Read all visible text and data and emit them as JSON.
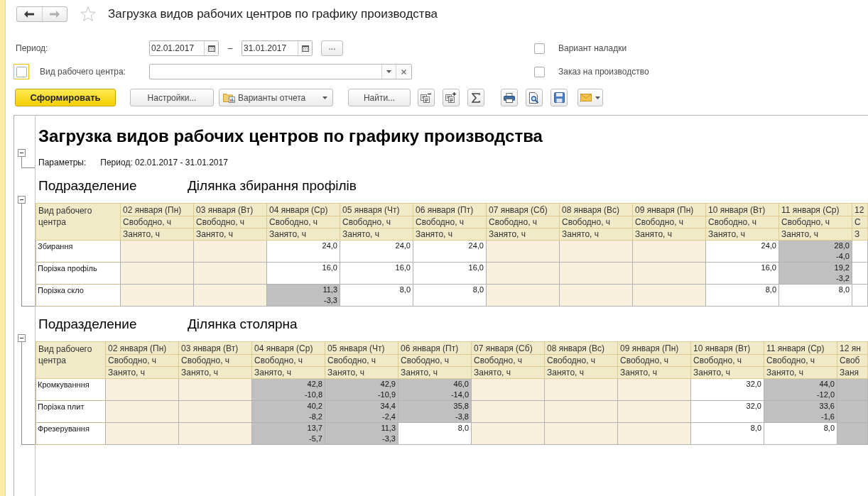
{
  "window": {
    "title": "Загрузка видов рабочих центров по графику производства",
    "favorite": false
  },
  "navigation": [
    {
      "kind": "back",
      "disabled": false
    },
    {
      "kind": "forward",
      "disabled": true
    }
  ],
  "filters": {
    "period": {
      "label": "Период:",
      "from": "02.01.2017",
      "separator": "–",
      "to": "31.01.2017",
      "more": "..."
    },
    "work_center": {
      "label": "Вид рабочего центра:",
      "checked": false,
      "focused": true
    },
    "options": [
      {
        "label": "Вариант наладки",
        "checked": false
      },
      {
        "label": "Заказ на производство",
        "checked": false
      }
    ]
  },
  "toolbar": [
    {
      "kind": "primary",
      "label": "Сформировать"
    },
    {
      "kind": "plain",
      "label": "Настройки..."
    },
    {
      "kind": "menu",
      "label": "Варианты отчета"
    },
    {
      "kind": "plain",
      "label": "Найти..."
    }
  ],
  "report": {
    "title": "Загрузка видов рабочих центров по графику производства",
    "expanded": true,
    "parameters_label": "Параметры:",
    "parameters_value": "Период: 02.01.2017 - 31.01.2017",
    "groups": [
      {
        "label": "Подразделение",
        "value": "Ділянка збирання профілів",
        "expanded": true,
        "corner_header": "Вид рабочего центра",
        "columns": [
          {
            "date": "02 января (Пн)",
            "free": "Свободно, ч",
            "busy": "Занято, ч"
          },
          {
            "date": "03 января (Вт)",
            "free": "Свободно, ч",
            "busy": "Занято, ч"
          },
          {
            "date": "04 января (Ср)",
            "free": "Свободно, ч",
            "busy": "Занято, ч"
          },
          {
            "date": "05 января (Чт)",
            "free": "Свободно, ч",
            "busy": "Занято, ч"
          },
          {
            "date": "06 января (Пт)",
            "free": "Свободно, ч",
            "busy": "Занято, ч"
          },
          {
            "date": "07 января (Сб)",
            "free": "Свободно, ч",
            "busy": "Занято, ч"
          },
          {
            "date": "08 января (Вс)",
            "free": "Свободно, ч",
            "busy": "Занято, ч"
          },
          {
            "date": "09 января (Пн)",
            "free": "Свободно, ч",
            "busy": "Занято, ч"
          },
          {
            "date": "10 января (Вт)",
            "free": "Свободно, ч",
            "busy": "Занято, ч"
          },
          {
            "date": "11 января (Ср)",
            "free": "Свободно, ч",
            "busy": "Занято, ч"
          },
          {
            "date": "12",
            "free": "С",
            "busy": "З"
          }
        ],
        "rows": [
          {
            "name": "Збирання",
            "cells": [
              {
                "kind": "off"
              },
              {
                "kind": "off"
              },
              {
                "kind": "free",
                "value": "24,0"
              },
              {
                "kind": "free",
                "value": "24,0"
              },
              {
                "kind": "free",
                "value": "24,0"
              },
              {
                "kind": "off"
              },
              {
                "kind": "off"
              },
              {
                "kind": "off"
              },
              {
                "kind": "free",
                "value": "24,0"
              },
              {
                "kind": "over",
                "value": "28,0",
                "deficit": "-4,0"
              },
              {
                "kind": "free"
              }
            ]
          },
          {
            "name": "Порізка профіль",
            "cells": [
              {
                "kind": "off"
              },
              {
                "kind": "off"
              },
              {
                "kind": "free",
                "value": "16,0"
              },
              {
                "kind": "free",
                "value": "16,0"
              },
              {
                "kind": "free",
                "value": "16,0"
              },
              {
                "kind": "off"
              },
              {
                "kind": "off"
              },
              {
                "kind": "off"
              },
              {
                "kind": "free",
                "value": "16,0"
              },
              {
                "kind": "over",
                "value": "19,2",
                "deficit": "-3,2"
              },
              {
                "kind": "free"
              }
            ]
          },
          {
            "name": "Порізка скло",
            "cells": [
              {
                "kind": "off"
              },
              {
                "kind": "off"
              },
              {
                "kind": "over",
                "value": "11,3",
                "deficit": "-3,3"
              },
              {
                "kind": "free",
                "value": "8,0"
              },
              {
                "kind": "free",
                "value": "8,0"
              },
              {
                "kind": "off"
              },
              {
                "kind": "off"
              },
              {
                "kind": "off"
              },
              {
                "kind": "free",
                "value": "8,0"
              },
              {
                "kind": "free",
                "value": "8,0"
              },
              {
                "kind": "free"
              }
            ]
          }
        ]
      },
      {
        "label": "Подразделение",
        "value": "Ділянка столярна",
        "expanded": true,
        "corner_header": "Вид рабочего центра",
        "columns": [
          {
            "date": "02 января (Пн)",
            "free": "Свободно, ч",
            "busy": "Занято, ч"
          },
          {
            "date": "03 января (Вт)",
            "free": "Свободно, ч",
            "busy": "Занято, ч"
          },
          {
            "date": "04 января (Ср)",
            "free": "Свободно, ч",
            "busy": "Занято, ч"
          },
          {
            "date": "05 января (Чт)",
            "free": "Свободно, ч",
            "busy": "Занято, ч"
          },
          {
            "date": "06 января (Пт)",
            "free": "Свободно, ч",
            "busy": "Занято, ч"
          },
          {
            "date": "07 января (Сб)",
            "free": "Свободно, ч",
            "busy": "Занято, ч"
          },
          {
            "date": "08 января (Вс)",
            "free": "Свободно, ч",
            "busy": "Занято, ч"
          },
          {
            "date": "09 января (Пн)",
            "free": "Свободно, ч",
            "busy": "Занято, ч"
          },
          {
            "date": "10 января (Вт)",
            "free": "Свободно, ч",
            "busy": "Занято, ч"
          },
          {
            "date": "11 января (Ср)",
            "free": "Свободно, ч",
            "busy": "Занято, ч"
          },
          {
            "date": "12 ян",
            "free": "Своб",
            "busy": "Заня"
          }
        ],
        "rows": [
          {
            "name": "Кромкуванння",
            "cells": [
              {
                "kind": "off"
              },
              {
                "kind": "off"
              },
              {
                "kind": "over",
                "value": "42,8",
                "deficit": "-10,8"
              },
              {
                "kind": "over",
                "value": "42,9",
                "deficit": "-10,9"
              },
              {
                "kind": "over",
                "value": "46,0",
                "deficit": "-14,0"
              },
              {
                "kind": "off"
              },
              {
                "kind": "off"
              },
              {
                "kind": "off"
              },
              {
                "kind": "free",
                "value": "32,0"
              },
              {
                "kind": "over",
                "value": "44,0",
                "deficit": "-12,0"
              },
              {
                "kind": "over"
              }
            ]
          },
          {
            "name": "Порізка плит",
            "cells": [
              {
                "kind": "off"
              },
              {
                "kind": "off"
              },
              {
                "kind": "over",
                "value": "40,2",
                "deficit": "-8,2"
              },
              {
                "kind": "over",
                "value": "34,4",
                "deficit": "-2,4"
              },
              {
                "kind": "over",
                "value": "35,8",
                "deficit": "-3,8"
              },
              {
                "kind": "off"
              },
              {
                "kind": "off"
              },
              {
                "kind": "off"
              },
              {
                "kind": "free",
                "value": "32,0"
              },
              {
                "kind": "over",
                "value": "33,6",
                "deficit": "-1,6"
              },
              {
                "kind": "over"
              }
            ]
          },
          {
            "name": "Фрезерування",
            "cells": [
              {
                "kind": "off"
              },
              {
                "kind": "off"
              },
              {
                "kind": "over",
                "value": "13,7",
                "deficit": "-5,7"
              },
              {
                "kind": "over",
                "value": "11,3",
                "deficit": "-3,3"
              },
              {
                "kind": "free",
                "value": "8,0"
              },
              {
                "kind": "off"
              },
              {
                "kind": "off"
              },
              {
                "kind": "off"
              },
              {
                "kind": "free",
                "value": "8,0"
              },
              {
                "kind": "free",
                "value": "8,0"
              },
              {
                "kind": "over"
              }
            ]
          }
        ]
      }
    ]
  }
}
